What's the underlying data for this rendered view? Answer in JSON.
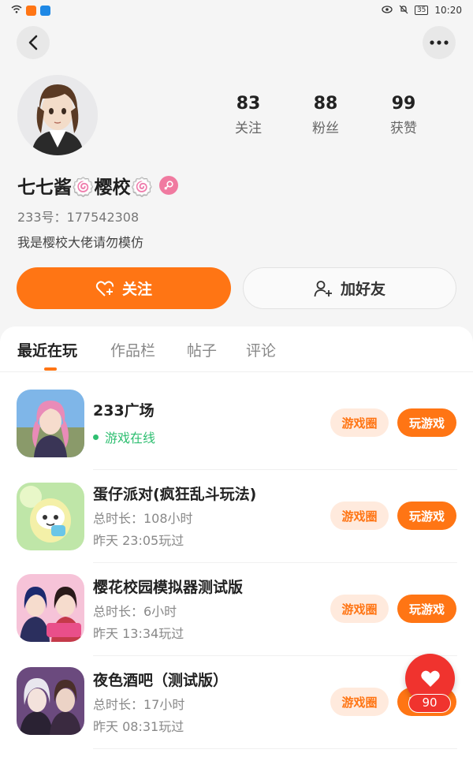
{
  "status_bar": {
    "time": "10:20",
    "battery": "35"
  },
  "profile": {
    "stats": [
      {
        "value": "83",
        "label": "关注"
      },
      {
        "value": "88",
        "label": "粉丝"
      },
      {
        "value": "99",
        "label": "获赞"
      }
    ],
    "name": "七七酱🍥樱校🍥",
    "uid": "233号：177542308",
    "bio": "我是樱校大佬请勿模仿"
  },
  "actions": {
    "follow": "关注",
    "add_friend": "加好友"
  },
  "tabs": [
    {
      "label": "最近在玩"
    },
    {
      "label": "作品栏"
    },
    {
      "label": "帖子"
    },
    {
      "label": "评论"
    }
  ],
  "games": [
    {
      "title": "233广场",
      "status": "游戏在线",
      "circle": "游戏圈",
      "play": "玩游戏"
    },
    {
      "title": "蛋仔派对(疯狂乱斗玩法)",
      "duration": "总时长：108小时",
      "last_played": "昨天 23:05玩过",
      "circle": "游戏圈",
      "play": "玩游戏"
    },
    {
      "title": "樱花校园模拟器测试版",
      "duration": "总时长：6小时",
      "last_played": "昨天 13:34玩过",
      "circle": "游戏圈",
      "play": "玩游戏"
    },
    {
      "title": "夜色酒吧（测试版）",
      "duration": "总时长：17小时",
      "last_played": "昨天 08:31玩过",
      "circle": "游戏圈",
      "play": "玩游戏"
    }
  ],
  "floating_like": {
    "count": "90"
  },
  "colors": {
    "accent": "#ff7514",
    "accent_light": "#ffeadd",
    "online": "#2fbf71",
    "like": "#f0332e"
  }
}
